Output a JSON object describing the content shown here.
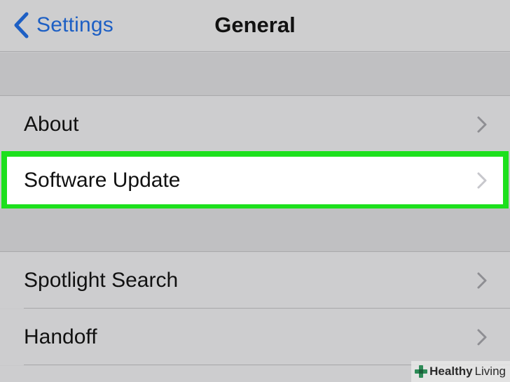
{
  "navbar": {
    "back_label": "Settings",
    "title": "General"
  },
  "rows": {
    "about": "About",
    "software_update": "Software Update",
    "spotlight": "Spotlight Search",
    "handoff": "Handoff"
  },
  "highlight_color": "#1de01d",
  "accent_color": "#1d5fc4",
  "watermark": {
    "brand_bold": "Healthy",
    "brand_light": "Living"
  },
  "icons": {
    "back": "chevron-left-icon",
    "disclosure": "chevron-right-icon",
    "brand": "cross-logo-icon"
  }
}
